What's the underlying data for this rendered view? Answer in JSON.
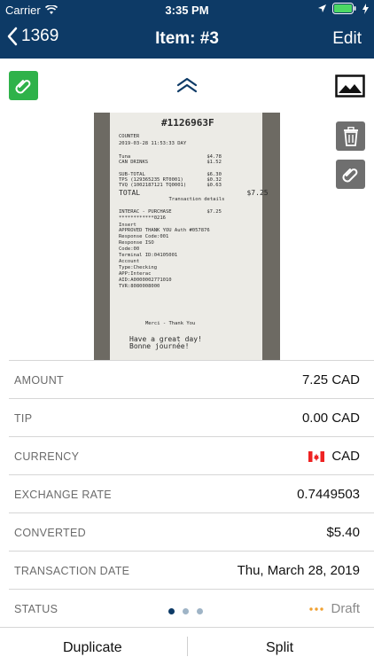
{
  "status_bar": {
    "carrier": "Carrier",
    "time": "3:35 PM"
  },
  "nav": {
    "back_label": "1369",
    "title": "Item: #3",
    "edit_label": "Edit"
  },
  "receipt": {
    "id": "#1126963F",
    "lines": [
      "COUNTER",
      "2019-03-28 11:53:33 DAY",
      "Tuna                          $4.78",
      "CAN DRINKS                    $1.52",
      "SUB-TOTAL                     $6.30",
      "TPS (129365235 RT0001)        $0.32",
      "TVQ (1002187121 TQ0001)       $0.63",
      "TOTAL                         $7.25",
      "        Transaction details",
      "INTERAC - PURCHASE            $7.25",
      "************0216",
      "Insert",
      "APPROVED THANK YOU Auth #057876",
      "Response Code:001",
      "Response ISO",
      "Code:00",
      "Terminal ID:04105001",
      "Account",
      "Type:Checking",
      "APP:Interac",
      "AID:A0000002771010",
      "TVR:8080008000",
      "Merci - Thank You",
      "Have a great day!",
      "Bonne journée!"
    ]
  },
  "fields": [
    {
      "label": "AMOUNT",
      "value": "7.25 CAD"
    },
    {
      "label": "TIP",
      "value": "0.00 CAD"
    },
    {
      "label": "CURRENCY",
      "value": "CAD",
      "icon": "canada-flag-icon"
    },
    {
      "label": "EXCHANGE RATE",
      "value": "0.7449503"
    },
    {
      "label": "CONVERTED",
      "value": "$5.40"
    },
    {
      "label": "TRANSACTION DATE",
      "value": "Thu, March 28, 2019"
    },
    {
      "label": "STATUS",
      "value": "Draft",
      "icon": "more-dots-icon"
    }
  ],
  "pager": {
    "count": 3,
    "active": 0
  },
  "footer": {
    "duplicate_label": "Duplicate",
    "split_label": "Split"
  },
  "colors": {
    "brand": "#0d3a66",
    "attach_green": "#2fb24a",
    "status_orange": "#f0a030"
  }
}
